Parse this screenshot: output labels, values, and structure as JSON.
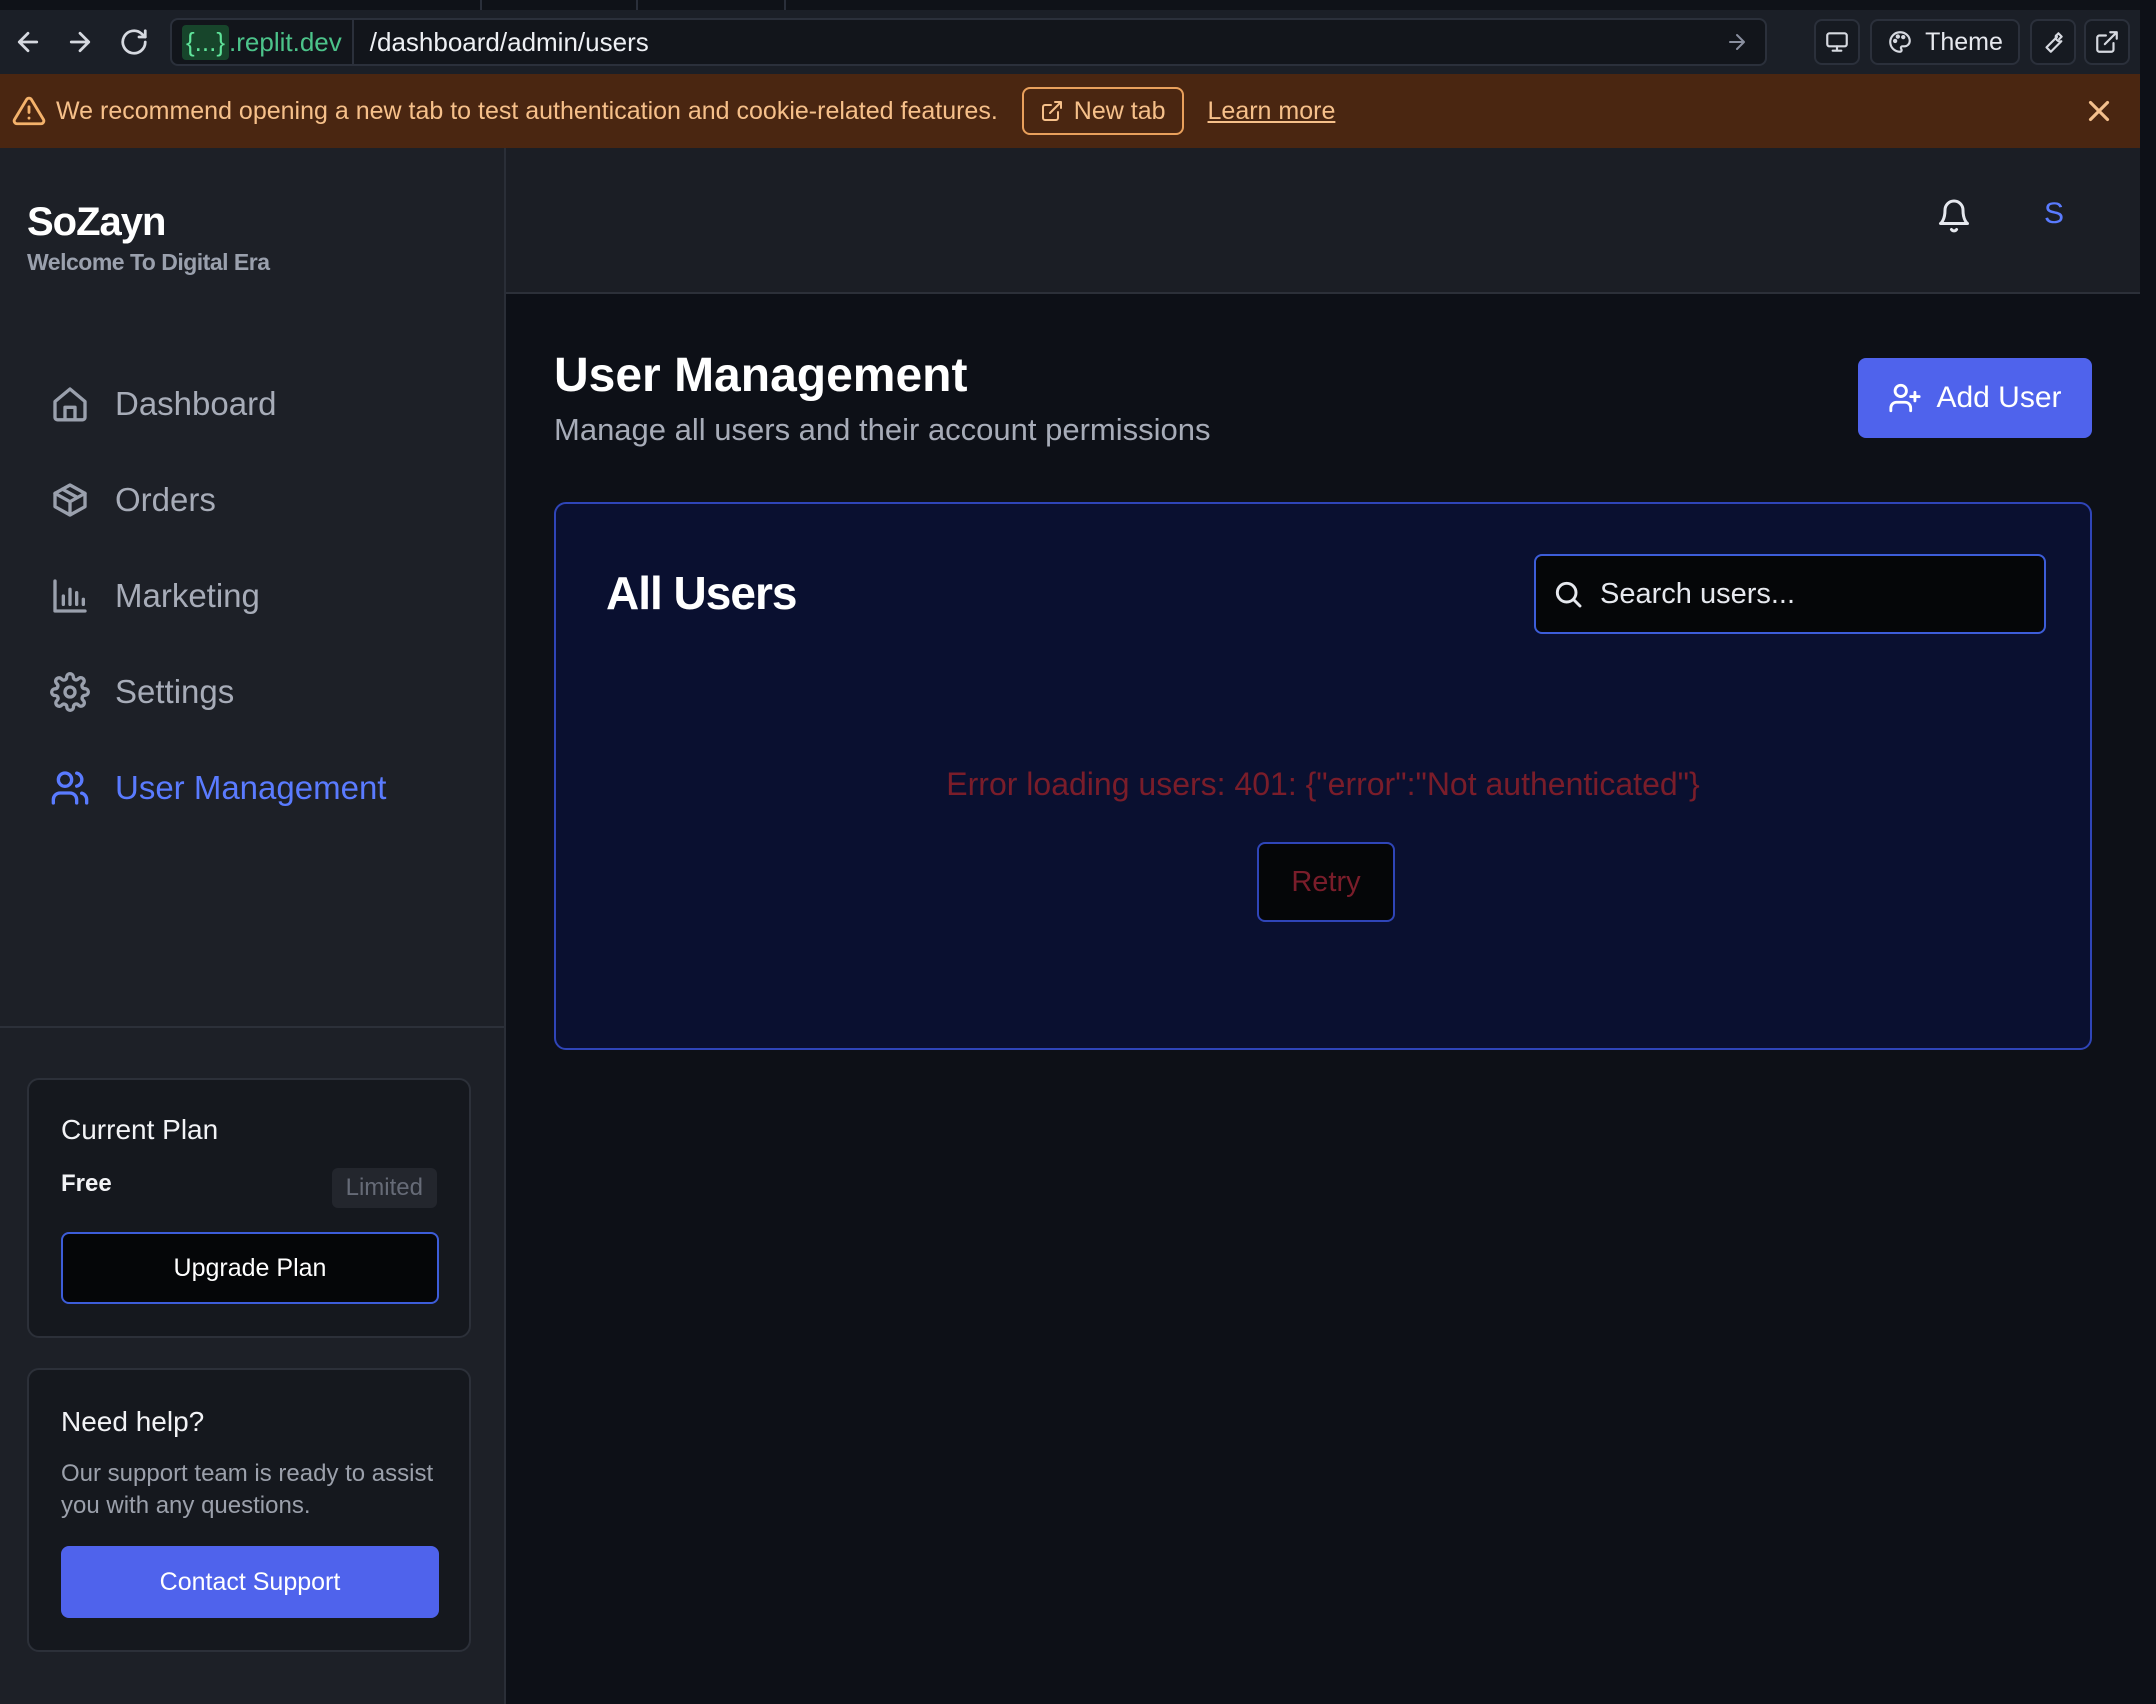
{
  "browser": {
    "url_domain_prefix": "{...}",
    "url_domain_suffix": ".replit.dev",
    "url_path": "/dashboard/admin/users",
    "theme_label": "Theme"
  },
  "banner": {
    "message": "We recommend opening a new tab to test authentication and cookie-related features.",
    "new_tab_label": "New tab",
    "learn_more_label": "Learn more",
    "background": "#4a2611",
    "text_color": "#f6c08a"
  },
  "sidebar": {
    "brand_name": "SoZayn",
    "brand_tagline": "Welcome To Digital Era",
    "items": [
      {
        "label": "Dashboard",
        "icon": "home-icon",
        "active": false
      },
      {
        "label": "Orders",
        "icon": "package-icon",
        "active": false
      },
      {
        "label": "Marketing",
        "icon": "bar-chart-icon",
        "active": false
      },
      {
        "label": "Settings",
        "icon": "gear-icon",
        "active": false
      },
      {
        "label": "User Management",
        "icon": "users-icon",
        "active": true
      }
    ],
    "plan": {
      "title": "Current Plan",
      "name": "Free",
      "badge": "Limited",
      "upgrade_label": "Upgrade Plan"
    },
    "help": {
      "title": "Need help?",
      "text": "Our support team is ready to assist you with any questions.",
      "contact_label": "Contact Support"
    }
  },
  "topbar": {
    "avatar_initial": "S"
  },
  "main": {
    "title": "User Management",
    "subtitle": "Manage all users and their account permissions",
    "add_user_label": "Add User",
    "users_card": {
      "title": "All Users",
      "search_placeholder": "Search users...",
      "error_message": "Error loading users: 401: {\"error\":\"Not authenticated\"}",
      "retry_label": "Retry"
    }
  },
  "colors": {
    "accent": "#4f63ec",
    "active_nav": "#5a7bff",
    "error": "#7a1d2a",
    "url_domain": "#4cc38a"
  }
}
